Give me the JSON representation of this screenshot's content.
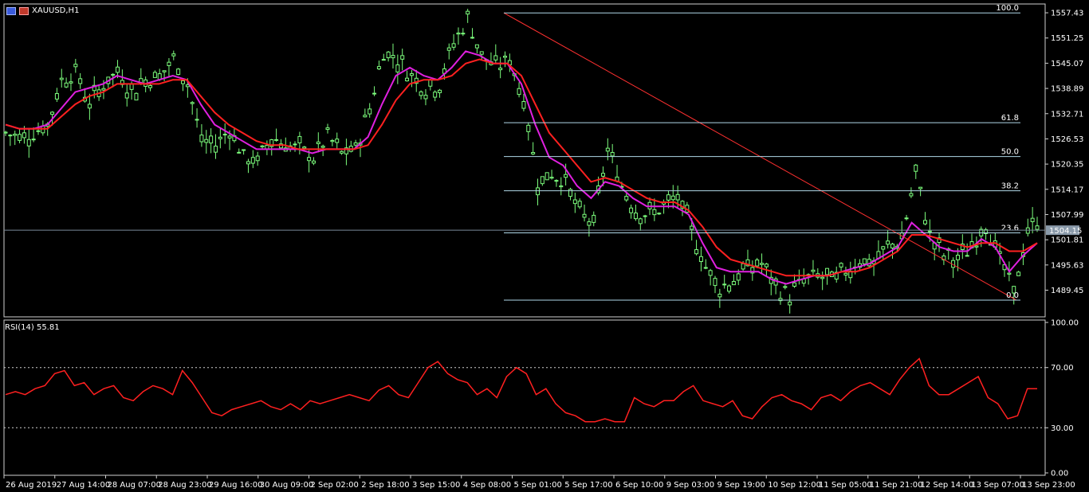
{
  "header": {
    "symbol": "XAUUSD,H1"
  },
  "rsi_header": "RSI(14) 55.81",
  "current_price": "1504.15",
  "chart_data": [
    {
      "type": "line",
      "title": "XAUUSD,H1",
      "ylim": [
        1483.5,
        1559.0
      ],
      "y_ticks": [
        "1557.43",
        "1551.25",
        "1545.07",
        "1538.89",
        "1532.71",
        "1526.53",
        "1520.35",
        "1514.17",
        "1507.99",
        "1501.81",
        "1495.63",
        "1489.45"
      ],
      "x_ticks": [
        "26 Aug 2019",
        "27 Aug 14:00",
        "28 Aug 07:00",
        "28 Aug 23:00",
        "29 Aug 16:00",
        "30 Aug 09:00",
        "2 Sep 02:00",
        "2 Sep 18:00",
        "3 Sep 15:00",
        "4 Sep 08:00",
        "5 Sep 01:00",
        "5 Sep 17:00",
        "6 Sep 10:00",
        "9 Sep 03:00",
        "9 Sep 19:00",
        "10 Sep 12:00",
        "11 Sep 05:00",
        "11 Sep 21:00",
        "12 Sep 14:00",
        "13 Sep 07:00",
        "13 Sep 23:00"
      ],
      "price_path": [
        [
          0,
          1528
        ],
        [
          3,
          1527
        ],
        [
          6,
          1528
        ],
        [
          9,
          1530
        ],
        [
          12,
          1541
        ],
        [
          15,
          1543
        ],
        [
          18,
          1535
        ],
        [
          21,
          1540
        ],
        [
          24,
          1543
        ],
        [
          27,
          1538
        ],
        [
          30,
          1541
        ],
        [
          33,
          1542
        ],
        [
          36,
          1546
        ],
        [
          39,
          1540
        ],
        [
          42,
          1526
        ],
        [
          45,
          1525
        ],
        [
          48,
          1529
        ],
        [
          51,
          1522
        ],
        [
          54,
          1521
        ],
        [
          57,
          1527
        ],
        [
          60,
          1525
        ],
        [
          63,
          1524
        ],
        [
          66,
          1522
        ],
        [
          69,
          1527
        ],
        [
          72,
          1523
        ],
        [
          75,
          1524
        ],
        [
          78,
          1534
        ],
        [
          81,
          1548
        ],
        [
          84,
          1546
        ],
        [
          87,
          1542
        ],
        [
          90,
          1539
        ],
        [
          93,
          1540
        ],
        [
          96,
          1550
        ],
        [
          99,
          1556
        ],
        [
          102,
          1547
        ],
        [
          105,
          1544
        ],
        [
          108,
          1546
        ],
        [
          111,
          1536
        ],
        [
          114,
          1516
        ],
        [
          117,
          1518
        ],
        [
          120,
          1516
        ],
        [
          123,
          1508
        ],
        [
          126,
          1506
        ],
        [
          129,
          1524
        ],
        [
          132,
          1515
        ],
        [
          135,
          1509
        ],
        [
          138,
          1508
        ],
        [
          141,
          1510
        ],
        [
          144,
          1512
        ],
        [
          147,
          1504
        ],
        [
          150,
          1495
        ],
        [
          153,
          1490
        ],
        [
          156,
          1492
        ],
        [
          159,
          1495
        ],
        [
          162,
          1496
        ],
        [
          165,
          1490
        ],
        [
          168,
          1488
        ],
        [
          171,
          1492
        ],
        [
          174,
          1493
        ],
        [
          177,
          1492
        ],
        [
          180,
          1494
        ],
        [
          183,
          1497
        ],
        [
          186,
          1496
        ],
        [
          189,
          1500
        ],
        [
          192,
          1502
        ],
        [
          195,
          1518
        ],
        [
          198,
          1503
        ],
        [
          201,
          1498
        ],
        [
          204,
          1497
        ],
        [
          207,
          1500
        ],
        [
          210,
          1506
        ],
        [
          213,
          1497
        ],
        [
          216,
          1489
        ],
        [
          219,
          1504
        ],
        [
          221,
          1506
        ]
      ],
      "series": [
        {
          "values": [
            1530,
            1529,
            1529,
            1530,
            1534,
            1538,
            1539,
            1540,
            1542,
            1541,
            1540,
            1541,
            1542,
            1541,
            1535,
            1530,
            1528,
            1526,
            1524,
            1524,
            1524,
            1524,
            1523,
            1524,
            1524,
            1524,
            1527,
            1535,
            1542,
            1544,
            1542,
            1541,
            1544,
            1548,
            1547,
            1545,
            1545,
            1540,
            1530,
            1522,
            1520,
            1515,
            1512,
            1516,
            1515,
            1512,
            1510,
            1510,
            1510,
            1508,
            1501,
            1495,
            1494,
            1494,
            1494,
            1492,
            1491,
            1492,
            1493,
            1493,
            1494,
            1495,
            1496,
            1498,
            1500,
            1506,
            1503,
            1500,
            1499,
            1499,
            1502,
            1500,
            1494,
            1498,
            1501
          ]
        },
        {
          "values": [
            1530,
            1529,
            1529,
            1529,
            1532,
            1535,
            1537,
            1538,
            1540,
            1540,
            1540,
            1540,
            1541,
            1541,
            1537,
            1533,
            1530,
            1528,
            1526,
            1525,
            1525,
            1524,
            1524,
            1524,
            1524,
            1524,
            1525,
            1530,
            1536,
            1540,
            1541,
            1541,
            1542,
            1545,
            1546,
            1545,
            1545,
            1542,
            1535,
            1528,
            1524,
            1520,
            1516,
            1517,
            1516,
            1514,
            1512,
            1511,
            1511,
            1509,
            1505,
            1500,
            1497,
            1496,
            1495,
            1494,
            1493,
            1493,
            1493,
            1493,
            1494,
            1494,
            1495,
            1497,
            1499,
            1503,
            1503,
            1502,
            1501,
            1500,
            1501,
            1501,
            1499,
            1499,
            1501
          ]
        }
      ],
      "series_colors": [
        "#e020e0",
        "#ff2020"
      ],
      "candle_color": "#7cfc7c",
      "fibonacci": {
        "levels": [
          {
            "label": "100.0",
            "price": 1557.4
          },
          {
            "label": "61.8",
            "price": 1530.5
          },
          {
            "label": "50.0",
            "price": 1522.2
          },
          {
            "label": "38.2",
            "price": 1513.8
          },
          {
            "label": "23.6",
            "price": 1503.5
          },
          {
            "label": "0.0",
            "price": 1487.0
          }
        ],
        "line_color": "#b0d8e8",
        "trend_color": "#ff3030"
      }
    },
    {
      "type": "line",
      "title": "RSI(14) 55.81",
      "ylim": [
        0,
        100
      ],
      "y_ticks": [
        "100.00",
        "70.00",
        "30.00",
        "0.00"
      ],
      "levels": [
        70,
        30
      ],
      "series": [
        {
          "values": [
            52,
            54,
            52,
            56,
            58,
            66,
            68,
            58,
            60,
            52,
            56,
            58,
            50,
            48,
            54,
            58,
            56,
            52,
            68,
            60,
            50,
            40,
            38,
            42,
            44,
            46,
            48,
            44,
            42,
            46,
            42,
            48,
            46,
            48,
            50,
            52,
            50,
            48,
            55,
            58,
            52,
            50,
            60,
            70,
            74,
            66,
            62,
            60,
            52,
            56,
            50,
            64,
            70,
            66,
            52,
            56,
            46,
            40,
            38,
            34,
            34,
            36,
            34,
            34,
            50,
            46,
            44,
            48,
            48,
            54,
            58,
            48,
            46,
            44,
            48,
            38,
            36,
            44,
            50,
            52,
            48,
            46,
            42,
            50,
            52,
            48,
            54,
            58,
            60,
            56,
            52,
            62,
            70,
            76,
            58,
            52,
            52,
            56,
            60,
            64,
            50,
            46,
            36,
            38,
            56,
            56
          ]
        }
      ],
      "series_colors": [
        "#ff2020"
      ]
    }
  ]
}
